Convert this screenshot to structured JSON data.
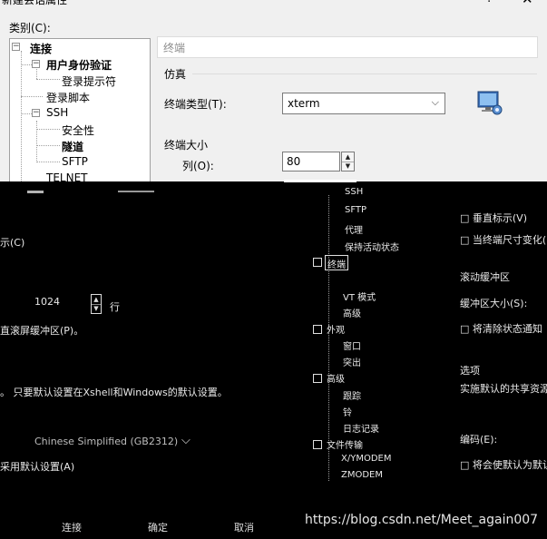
{
  "window": {
    "title": "新建会话属性",
    "help_glyph": "?",
    "close_glyph": "✕"
  },
  "category_label": "类别(C):",
  "tree": {
    "root": "连接",
    "auth": "用户身份验证",
    "login_prompt": "登录提示符",
    "login_script": "登录脚本",
    "ssh": "SSH",
    "security": "安全性",
    "tunnel": "隧道",
    "sftp": "SFTP",
    "telnet": "TELNET"
  },
  "panel": {
    "header": "终端",
    "emulation_title": "仿真",
    "terminal_type_label": "终端类型(T):",
    "terminal_type_value": "xterm",
    "terminal_size_title": "终端大小",
    "columns_label": "列(O):",
    "columns_value": "80"
  },
  "glitch": {
    "tree_items": [
      "SSH",
      "SFTP",
      "代理",
      "保持活动状态",
      "终端",
      "VT 模式",
      "高级",
      "外观",
      "窗口",
      "突出",
      "高级",
      "跟踪",
      "铃",
      "日志记录",
      "文件传输",
      "X/YMODEM",
      "ZMODEM"
    ],
    "right_text_1": "□ 垂直标示(V)",
    "right_text_2": "□ 当终端尺寸变化(F)",
    "mid_text_1": "示(C)",
    "mid_value": "1024",
    "mid_label_line": "行",
    "mid_text_2": "直滚屏缓冲区(P)。",
    "right_text_3": "滚动缓冲区",
    "right_text_4": "缓冲区大小(S):",
    "right_text_5": "□ 将清除状态通知",
    "right_text_6": "选项",
    "mid_text_3": "。 只要默认设置在Xshell和Windows的默认设置。",
    "right_text_7": "实施默认的共享资源",
    "combo_text": "Chinese Simplified (GB2312)",
    "right_text_8": "编码(E):",
    "mid_text_4": "采用默认设置(A)",
    "right_text_9": "□ 将会使默认为默认",
    "btn_connect": "连接",
    "btn_ok": "确定",
    "btn_cancel": "取消"
  },
  "watermark": "https://blog.csdn.net/Meet_again007"
}
